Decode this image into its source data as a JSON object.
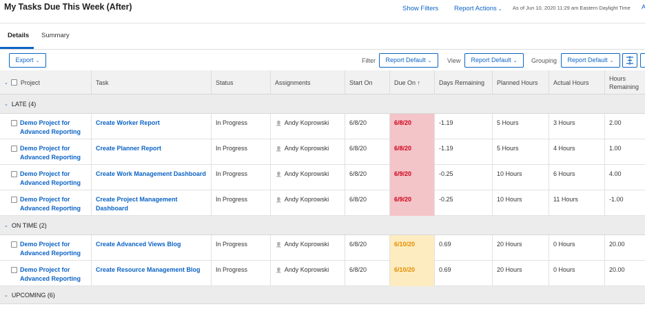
{
  "header": {
    "title": "My Tasks Due This Week (After)",
    "show_filters": "Show Filters",
    "report_actions": "Report Actions",
    "as_of": "As of Jun 10, 2020 11:29 am Eastern Daylight Time",
    "corner_link": "A"
  },
  "tabs": [
    {
      "label": "Details",
      "active": true
    },
    {
      "label": "Summary",
      "active": false
    }
  ],
  "toolbar": {
    "export_label": "Export",
    "filter_label": "Filter",
    "filter_value": "Report Default",
    "view_label": "View",
    "view_value": "Report Default",
    "grouping_label": "Grouping",
    "grouping_value": "Report Default"
  },
  "columns": {
    "project": "Project",
    "task": "Task",
    "status": "Status",
    "assignments": "Assignments",
    "start_on": "Start On",
    "due_on": "Due On ↑",
    "days_remaining": "Days Remaining",
    "planned_hours": "Planned Hours",
    "actual_hours": "Actual Hours",
    "hours_remaining_1": "Hours",
    "hours_remaining_2": "Remaining"
  },
  "groups": [
    {
      "label": "LATE (4)",
      "rows": [
        {
          "project_1": "Demo Project for",
          "project_2": "Advanced Reporting",
          "task": "Create Worker Report",
          "status": "In Progress",
          "assignee": "Andy Koprowski",
          "start": "6/8/20",
          "due": "6/8/20",
          "days": "-1.19",
          "planned": "5 Hours",
          "actual": "3 Hours",
          "remaining": "2.00"
        },
        {
          "project_1": "Demo Project for",
          "project_2": "Advanced Reporting",
          "task": "Create Planner Report",
          "status": "In Progress",
          "assignee": "Andy Koprowski",
          "start": "6/8/20",
          "due": "6/8/20",
          "days": "-1.19",
          "planned": "5 Hours",
          "actual": "4 Hours",
          "remaining": "1.00"
        },
        {
          "project_1": "Demo Project for",
          "project_2": "Advanced Reporting",
          "task": "Create Work Management Dashboard",
          "status": "In Progress",
          "assignee": "Andy Koprowski",
          "start": "6/8/20",
          "due": "6/9/20",
          "days": "-0.25",
          "planned": "10 Hours",
          "actual": "6 Hours",
          "remaining": "4.00"
        },
        {
          "project_1": "Demo Project for",
          "project_2": "Advanced Reporting",
          "task": "Create Project Management Dashboard",
          "status": "In Progress",
          "assignee": "Andy Koprowski",
          "start": "6/8/20",
          "due": "6/9/20",
          "days": "-0.25",
          "planned": "10 Hours",
          "actual": "11 Hours",
          "remaining": "-1.00"
        }
      ]
    },
    {
      "label": "ON TIME (2)",
      "rows": [
        {
          "project_1": "Demo Project for",
          "project_2": "Advanced Reporting",
          "task": "Create Advanced Views Blog",
          "status": "In Progress",
          "assignee": "Andy Koprowski",
          "start": "6/8/20",
          "due": "6/10/20",
          "days": "0.69",
          "planned": "20 Hours",
          "actual": "0 Hours",
          "remaining": "20.00"
        },
        {
          "project_1": "Demo Project for",
          "project_2": "Advanced Reporting",
          "task": "Create Resource Management Blog",
          "status": "In Progress",
          "assignee": "Andy Koprowski",
          "start": "6/8/20",
          "due": "6/10/20",
          "days": "0.69",
          "planned": "20 Hours",
          "actual": "0 Hours",
          "remaining": "20.00"
        }
      ]
    },
    {
      "label": "UPCOMING (6)",
      "rows": []
    }
  ]
}
